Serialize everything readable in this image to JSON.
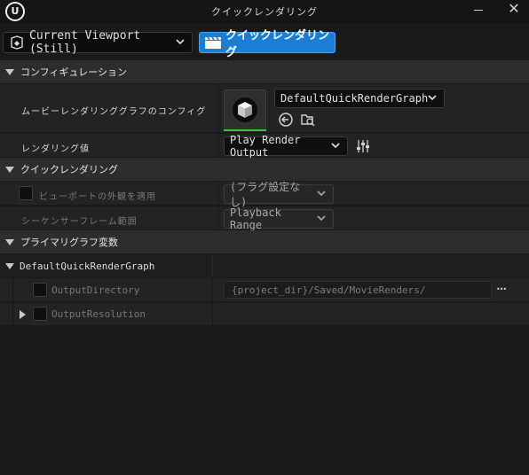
{
  "window": {
    "title": "クイックレンダリング",
    "logo_letter": "U",
    "close_glyph": "✕"
  },
  "toolbar": {
    "viewport_label": "Current Viewport (Still)",
    "quick_render_label": "クイックレンダリング",
    "accent_color": "#1a7fd4"
  },
  "sections": {
    "config": "コンフィギュレーション",
    "quick_render": "クイックレンダリング",
    "primary_graph_vars": "プライマリグラフ変数"
  },
  "config": {
    "graph_config_label": "ムービーレンダリンググラフのコンフィグ",
    "graph_asset_value": "DefaultQuickRenderGraph",
    "render_target_label": "レンダリング値",
    "render_target_value": "Play Render Output"
  },
  "quick_render": {
    "apply_viewport_label": "ビューポートの外観を適用",
    "apply_viewport_value": "(フラグ設定なし)",
    "sequencer_range_label": "シーケンサーフレーム範囲",
    "sequencer_range_value": "Playback Range"
  },
  "graph_vars": {
    "graph_name": "DefaultQuickRenderGraph",
    "output_directory_label": "OutputDirectory",
    "output_directory_value": "{project_dir}/Saved/MovieRenders/",
    "output_resolution_label": "OutputResolution",
    "more_glyph": "•••"
  },
  "icons": [
    "unreal-logo-icon",
    "minimize-icon",
    "close-icon",
    "viewport-camera-icon",
    "clapperboard-icon",
    "chevron-down-icon",
    "cube-thumbnail-icon",
    "browse-back-icon",
    "browse-folder-icon",
    "settings-sliders-icon",
    "expand-arrow-icon"
  ]
}
